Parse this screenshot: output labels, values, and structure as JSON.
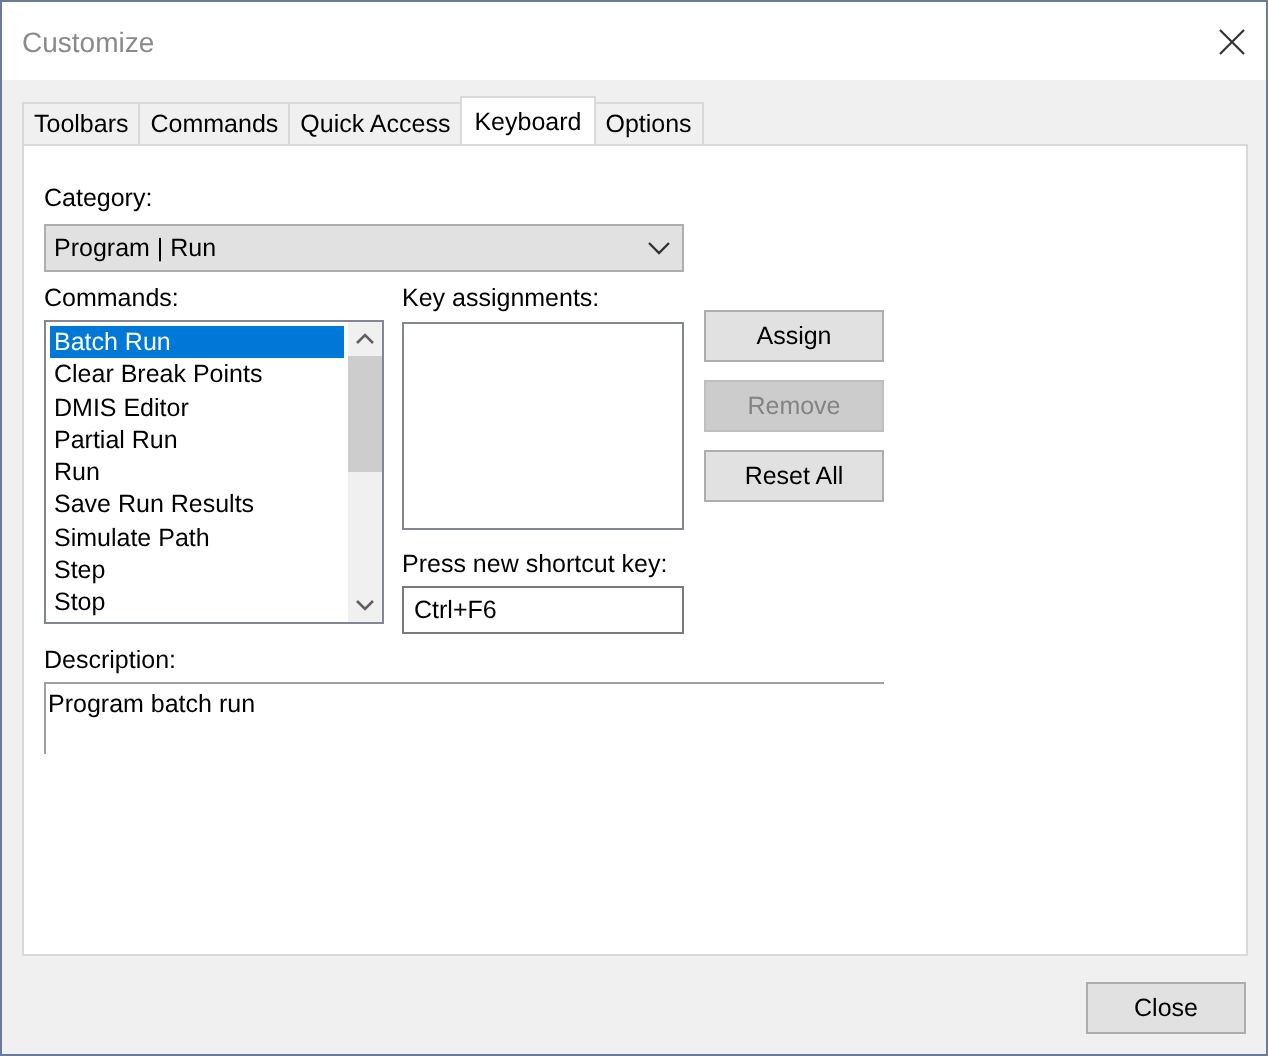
{
  "window": {
    "title": "Customize"
  },
  "tabs": [
    {
      "label": "Toolbars",
      "selected": false
    },
    {
      "label": "Commands",
      "selected": false
    },
    {
      "label": "Quick Access",
      "selected": false
    },
    {
      "label": "Keyboard",
      "selected": true
    },
    {
      "label": "Options",
      "selected": false
    }
  ],
  "keyboard": {
    "category": {
      "label": "Category:",
      "value": "Program | Run"
    },
    "commands": {
      "label": "Commands:",
      "items": [
        {
          "label": "Batch Run",
          "selected": true
        },
        {
          "label": "Clear Break Points",
          "selected": false
        },
        {
          "label": "DMIS Editor",
          "selected": false
        },
        {
          "label": "Partial Run",
          "selected": false
        },
        {
          "label": "Run",
          "selected": false
        },
        {
          "label": "Save Run Results",
          "selected": false
        },
        {
          "label": "Simulate Path",
          "selected": false
        },
        {
          "label": "Step",
          "selected": false
        },
        {
          "label": "Stop",
          "selected": false
        }
      ]
    },
    "key_assignments": {
      "label": "Key assignments:"
    },
    "buttons": [
      {
        "label": "Assign",
        "disabled": false
      },
      {
        "label": "Remove",
        "disabled": true
      },
      {
        "label": "Reset All",
        "disabled": false
      }
    ],
    "shortcut": {
      "label": "Press new shortcut key:",
      "value": "Ctrl+F6"
    },
    "description": {
      "label": "Description:",
      "text": "Program batch run"
    }
  },
  "footer": {
    "buttons": [
      "Close"
    ]
  }
}
